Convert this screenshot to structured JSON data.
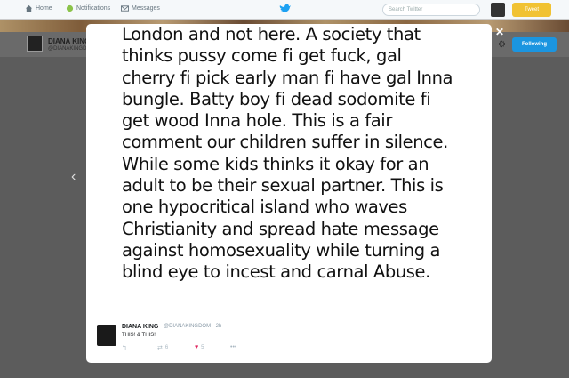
{
  "nav": {
    "home": "Home",
    "notifications": "Notifications",
    "messages": "Messages",
    "search_placeholder": "Search Twitter",
    "tweet_button": "Tweet"
  },
  "profile": {
    "name": "DIANA KING",
    "handle": "@DIANAKINGDOM",
    "follow_button": "Following"
  },
  "tweet": {
    "lines": [
      "London and not here. A society that",
      "thinks pussy  come fi get fuck, gal",
      "cherry fi pick early man fi have gal Inna",
      "bungle. Batty boy fi dead sodomite fi",
      "get wood Inna hole. This is a fair",
      "comment our children suffer in silence.",
      "While some kids thinks it okay for an",
      "adult to be their sexual partner. This is",
      "one hypocritical island who waves",
      "Christianity and spread hate message",
      "against homosexuality while turning a",
      "blind eye to incest and carnal Abuse."
    ],
    "author_name": "DIANA KING",
    "author_handle": "@DIANAKINGDOM",
    "time": "· 2h",
    "text": "THIS! & THIS!",
    "retweets": "6",
    "likes": "5"
  },
  "icons": {
    "close": "✕",
    "prev": "‹",
    "reply": "↰",
    "retweet": "⇄",
    "like": "♥",
    "more": "•••",
    "gear": "⚙"
  }
}
